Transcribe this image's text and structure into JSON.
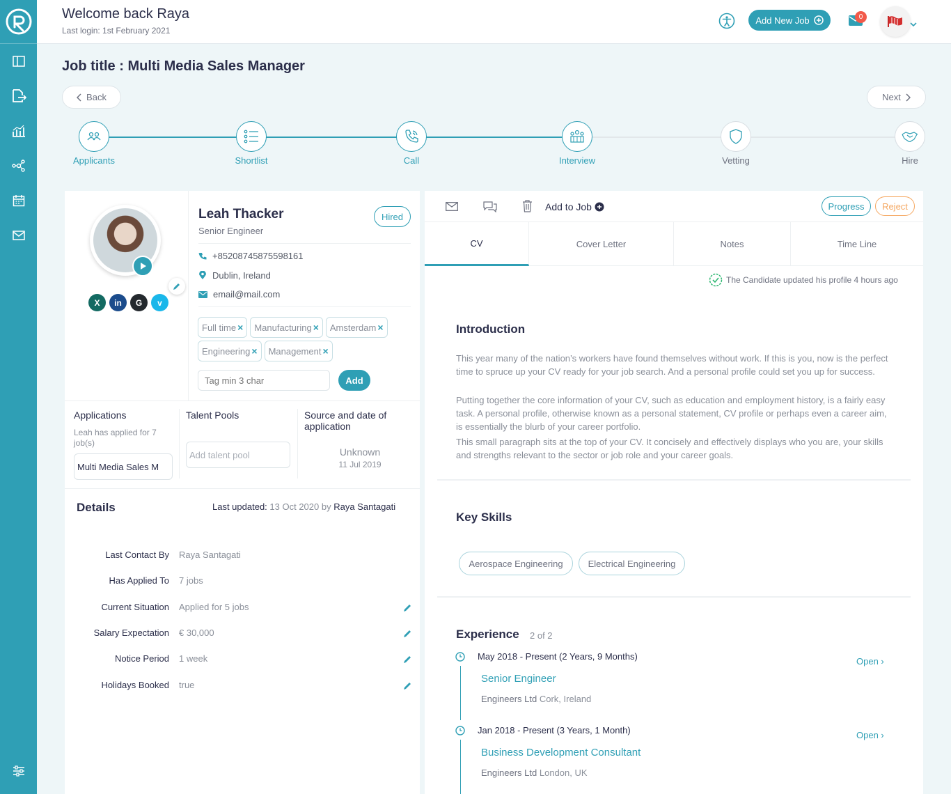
{
  "header": {
    "welcome": "Welcome back Raya",
    "last_login": "Last login: 1st February 2021",
    "add_job_label": "Add New Job",
    "notification_count": "0"
  },
  "job": {
    "title": "Job title : Multi Media Sales Manager",
    "back_label": "Back",
    "next_label": "Next"
  },
  "pipeline": {
    "steps": [
      {
        "label": "Applicants",
        "icon": "applicants-icon",
        "active": true
      },
      {
        "label": "Shortlist",
        "icon": "list-icon",
        "active": true
      },
      {
        "label": "Call",
        "icon": "phone-icon",
        "active": true
      },
      {
        "label": "Interview",
        "icon": "group-icon",
        "active": true
      },
      {
        "label": "Vetting",
        "icon": "shield-icon",
        "active": false
      },
      {
        "label": "Hire",
        "icon": "handshake-icon",
        "active": false
      }
    ]
  },
  "candidate": {
    "name": "Leah Thacker",
    "role": "Senior Engineer",
    "status": "Hired",
    "phone": "+85208745875598161",
    "location": "Dublin, Ireland",
    "email": "email@mail.com",
    "socials": [
      {
        "letter": "X",
        "color": "#136a62"
      },
      {
        "letter": "in",
        "color": "#1b4c8c"
      },
      {
        "letter": "G",
        "color": "#24292e"
      },
      {
        "letter": "v",
        "color": "#1ab7ea"
      }
    ],
    "tags": [
      "Full time",
      "Manufacturing",
      "Amsterdam",
      "Engineering",
      "Management"
    ],
    "tag_placeholder": "Tag min 3 char",
    "add_label": "Add"
  },
  "applications": {
    "title": "Applications",
    "subtitle": "Leah has applied for 7 job(s)",
    "selected": "Multi Media Sales M"
  },
  "talent_pools": {
    "title": "Talent Pools",
    "placeholder": "Add talent pool"
  },
  "source": {
    "title": "Source and date of application",
    "value": "Unknown",
    "date": "11 Jul 2019"
  },
  "details": {
    "title": "Details",
    "last_updated_label": "Last updated:",
    "last_updated_date": "13 Oct 2020 by",
    "last_updated_by": "Raya Santagati",
    "rows": [
      {
        "key": "Last Contact By",
        "value": "Raya Santagati",
        "editable": false
      },
      {
        "key": "Has Applied To",
        "value": "7 jobs",
        "editable": false
      },
      {
        "key": "Current Situation",
        "value": "Applied for 5 jobs",
        "editable": true
      },
      {
        "key": "Salary Expectation",
        "value": "€ 30,000",
        "editable": true
      },
      {
        "key": "Notice Period",
        "value": "1 week",
        "editable": true
      },
      {
        "key": "Holidays Booked",
        "value": "true",
        "editable": true
      }
    ]
  },
  "actions": {
    "add_to_job": "Add to Job",
    "progress": "Progress",
    "reject": "Reject"
  },
  "tabs": [
    "CV",
    "Cover Letter",
    "Notes",
    "Time Line"
  ],
  "cv": {
    "updated_note": "The Candidate updated his profile 4 hours ago",
    "intro_title": "Introduction",
    "intro_paragraphs": [
      "This year many of the nation’s workers have found themselves without work. If this is you, now is the perfect time to spruce up your CV ready for your job search. And a personal profile could set you up for success.",
      "Putting together the core information of your CV, such as education and employment history, is a fairly easy task. A personal profile, otherwise known as a personal statement, CV profile or perhaps even a career aim, is essentially the blurb of your career portfolio.",
      "This small paragraph sits at the top of your CV. It concisely and effectively displays who you are, your skills and strengths relevant to the sector or job role and your career goals."
    ],
    "skills_title": "Key Skills",
    "skills": [
      "Aerospace Engineering",
      "Electrical Engineering"
    ],
    "experience_title": "Experience",
    "experience_count": "2 of 2",
    "experiences": [
      {
        "dates": "May 2018 - Present (2 Years, 9 Months)",
        "title": "Senior Engineer",
        "company": "Engineers Ltd",
        "location": "Cork, Ireland",
        "open": "Open ›"
      },
      {
        "dates": "Jan 2018 - Present (3 Years, 1 Month)",
        "title": "Business Development Consultant",
        "company": "Engineers Ltd",
        "location": "London, UK",
        "open": "Open ›"
      }
    ]
  },
  "colors": {
    "accent": "#2f9fb5",
    "reject": "#f5a760",
    "badge": "#f25a4a"
  }
}
